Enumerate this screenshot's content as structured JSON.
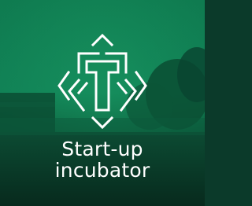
{
  "tile": {
    "line1": "Start-up",
    "line2": "incubator",
    "icon": "t-frame-logo-icon",
    "overlay_color": "#0f6e4a",
    "text_color": "#ffffff"
  }
}
